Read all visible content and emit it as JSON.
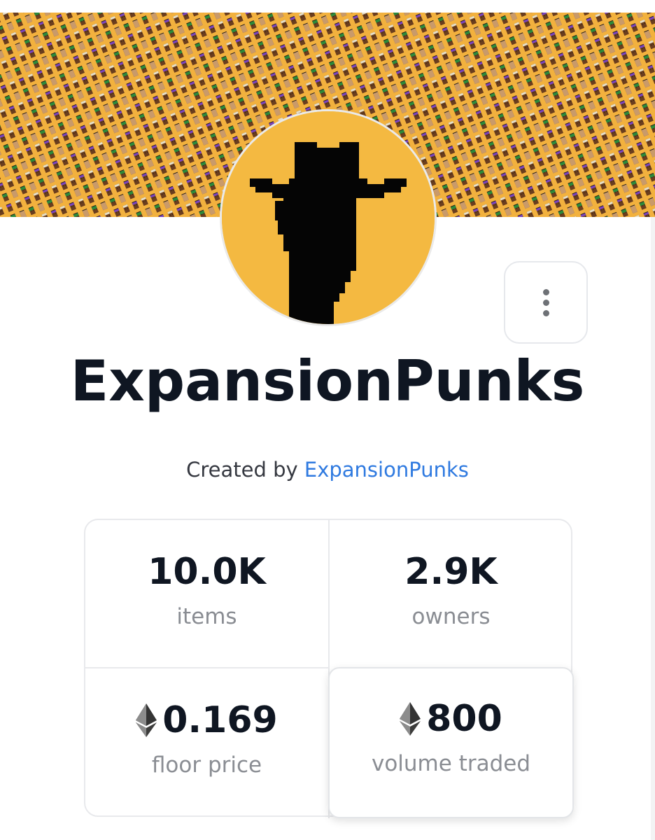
{
  "collection": {
    "name": "ExpansionPunks",
    "created_by_prefix": "Created by",
    "creator": "ExpansionPunks"
  },
  "stats": {
    "items": {
      "value": "10.0K",
      "label": "items"
    },
    "owners": {
      "value": "2.9K",
      "label": "owners"
    },
    "floor": {
      "value": "0.169",
      "label": "floor price",
      "icon": "ethereum-icon"
    },
    "volume": {
      "value": "800",
      "label": "volume traded",
      "icon": "ethereum-icon"
    }
  },
  "colors": {
    "banner": "#f2b13e",
    "avatar_bg": "#f4b941",
    "title": "#0f1622",
    "link": "#2f7ae0",
    "muted": "#8a8d93"
  },
  "icons": {
    "more": "vertical-dots-icon"
  }
}
